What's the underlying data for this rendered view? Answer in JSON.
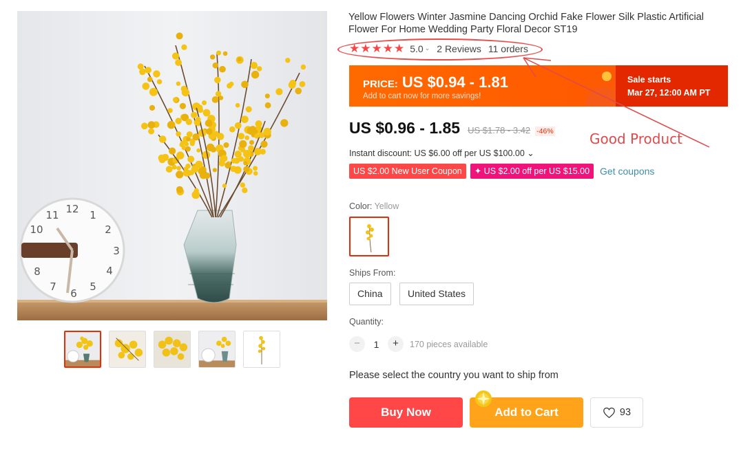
{
  "product": {
    "title": "Yellow Flowers Winter Jasmine Dancing Orchid Fake Flower Silk Plastic Artificial Flower For Home Wedding Party Floral Decor ST19",
    "rating": {
      "stars": 5,
      "value": "5.0",
      "reviews": "2 Reviews",
      "orders": "11 orders"
    },
    "banner": {
      "price_label": "PRICE:",
      "price_value": "US $0.94 - 1.81",
      "subtext": "Add to cart now for more savings!",
      "sale_title": "Sale starts",
      "sale_date": "Mar 27, 12:00 AM PT"
    },
    "price": {
      "current": "US $0.96 - 1.85",
      "original": "US $1.78 - 3.42",
      "discount": "-46%"
    },
    "instant_discount": "Instant discount: US $6.00 off per US $100.00 ⌄",
    "coupons": [
      {
        "label": "US $2.00 New User Coupon"
      },
      {
        "label": "✦ US $2.00 off per US $15.00"
      }
    ],
    "get_coupons": "Get coupons",
    "color": {
      "label": "Color:",
      "value": "Yellow"
    },
    "ships_from": {
      "label": "Ships From:",
      "options": [
        "China",
        "United States"
      ]
    },
    "quantity": {
      "label": "Quantity:",
      "minus": "−",
      "plus": "+",
      "value": "1",
      "available": "170 pieces available"
    },
    "ship_note": "Please select the country you want to ship from",
    "actions": {
      "buy_now": "Buy Now",
      "add_to_cart": "Add to Cart",
      "wishlist_count": "93"
    }
  },
  "gallery": {
    "thumbnail_count": 5,
    "active_index": 0,
    "clock_numbers": [
      "12",
      "1",
      "2",
      "3",
      "4",
      "5",
      "6",
      "7",
      "8",
      "9",
      "10",
      "11"
    ]
  },
  "annotation": {
    "text": "Good Product",
    "color": "#e04a4a"
  },
  "colors": {
    "accent": "#ff4747",
    "banner": "#ff6a00",
    "sale": "#e32800",
    "cart": "#ffa41a",
    "flower": "#f5c315"
  }
}
